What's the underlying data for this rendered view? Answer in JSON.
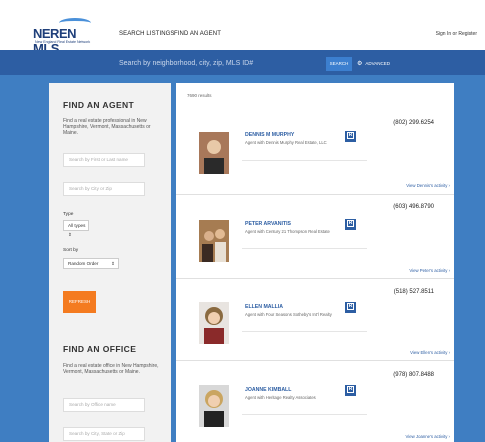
{
  "header": {
    "logo_text": "NEREN MLS",
    "logo_sub": "New England Real Estate Network",
    "nav": [
      "SEARCH LISTINGS",
      "FIND AN AGENT"
    ],
    "signin": "Sign In or Register"
  },
  "search": {
    "placeholder": "Search by neighborhood, city, zip, MLS ID#",
    "button": "SEARCH",
    "advanced": "ADVANCED"
  },
  "sidebar": {
    "agent_title": "FIND AN AGENT",
    "agent_desc": "Find a real estate professional in New Hampshire, Vermont, Massachusetts or Maine.",
    "name_placeholder": "Search by First or Last name",
    "city_placeholder": "Search by City or Zip",
    "type_label": "Type",
    "type_value": "All types",
    "sort_label": "Sort by",
    "sort_value": "Random Order",
    "refresh": "REFRESH",
    "office_title": "FIND AN OFFICE",
    "office_desc": "Find a real estate office in New Hampshire, Vermont, Massachusetts or Maine.",
    "office_name_placeholder": "Search by Office name",
    "office_city_placeholder": "Search by City, State or Zip"
  },
  "results": {
    "count": "7690 results",
    "agents": [
      {
        "phone": "(802) 299.6254",
        "name": "DENNIS M MURPHY",
        "agency": "Agent with Dennis Murphy Real Estate, LLC",
        "activity": "View Dennis's activity ›",
        "photo_bg": "#a8785a",
        "photo_fg": "#2a2a2a"
      },
      {
        "phone": "(603) 496.8790",
        "name": "PETER ARVANITIS",
        "agency": "Agent with Century 21 Thompson Real Estate",
        "activity": "View Peter's activity ›",
        "photo_bg": "#a67c52",
        "photo_fg": "#3a2a22"
      },
      {
        "phone": "(518) 527.8511",
        "name": "ELLEN MALLIA",
        "agency": "Agent with Four Seasons Sotheby's Int'l Realty",
        "activity": "View Ellen's activity ›",
        "photo_bg": "#e8e4e0",
        "photo_fg": "#8a2a2a"
      },
      {
        "phone": "(978) 807.8488",
        "name": "JOANNE KIMBALL",
        "agency": "Agent with Heritage Realty Associates",
        "activity": "View Joanne's activity ›",
        "photo_bg": "#d8d8d8",
        "photo_fg": "#222"
      }
    ]
  },
  "colors": {
    "accent": "#2d5ea3",
    "refresh": "#f47b20"
  }
}
